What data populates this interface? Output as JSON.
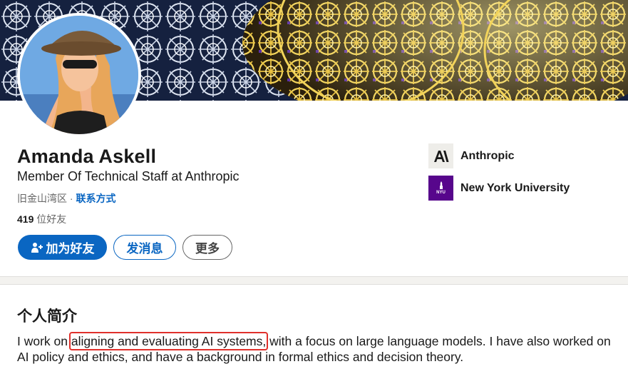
{
  "profile": {
    "name": "Amanda Askell",
    "headline": "Member Of Technical Staff at Anthropic",
    "location": "旧金山湾区",
    "separator": " · ",
    "contact_label": "联系方式",
    "friends_count": "419",
    "friends_label": " 位好友"
  },
  "actions": {
    "add_friend_label": "加为好友",
    "message_label": "发消息",
    "more_label": "更多"
  },
  "experience": [
    {
      "name": "Anthropic",
      "logo_text": "A\\",
      "icon": "anthropic-logo"
    },
    {
      "name": "New York University",
      "logo_text": "NYU",
      "icon": "nyu-logo"
    }
  ],
  "about": {
    "title": "个人简介",
    "text_before": "I work on ",
    "text_highlight": "aligning and evaluating AI systems,",
    "text_after": " with a focus on large language models. I have also worked on AI policy and ethics, and have a background in formal ethics and decision theory."
  },
  "colors": {
    "primary_blue": "#0a66c2",
    "highlight_box": "#e0302b",
    "nyu_purple": "#57068c"
  }
}
